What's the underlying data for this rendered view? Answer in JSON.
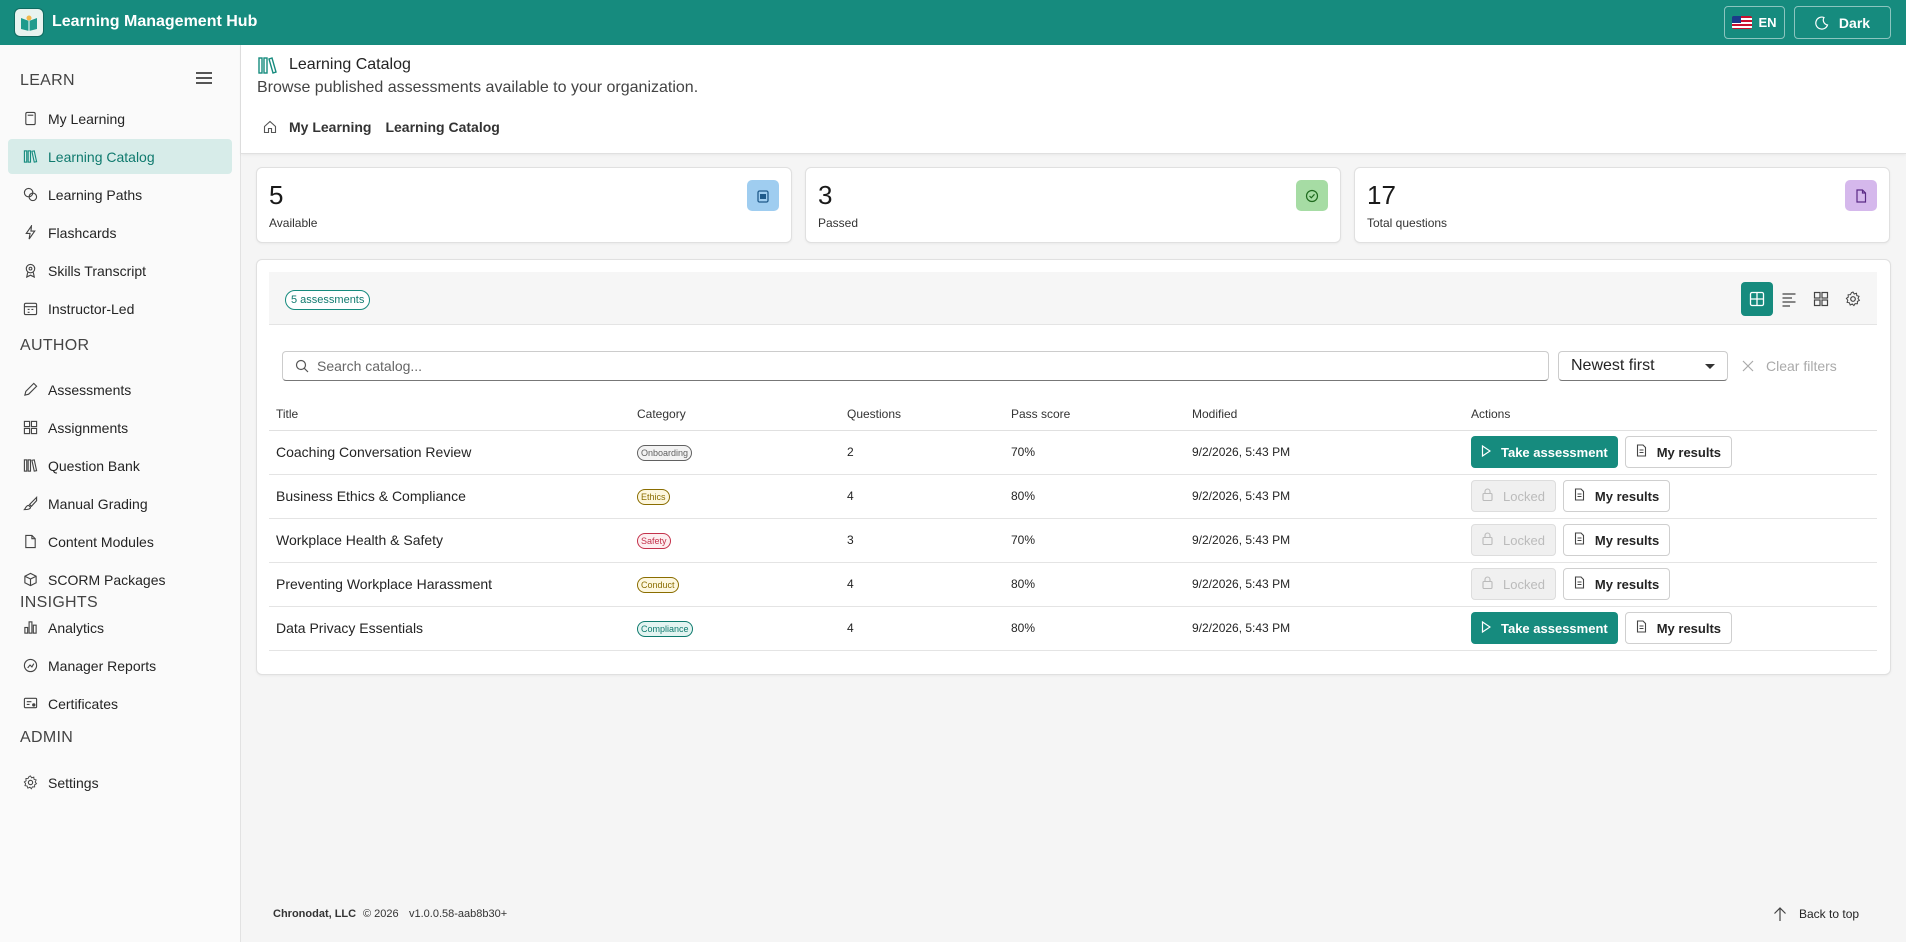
{
  "app": {
    "title": "Learning Management Hub",
    "language": "EN",
    "theme_label": "Dark"
  },
  "colors": {
    "brand": "#168b7e",
    "active_bg": "#d7ece9"
  },
  "sidebar": {
    "sections": [
      {
        "heading": "LEARN",
        "items": [
          {
            "label": "My Learning",
            "icon": "book-icon"
          },
          {
            "label": "Learning Catalog",
            "icon": "library-icon",
            "active": true
          },
          {
            "label": "Learning Paths",
            "icon": "paths-icon"
          },
          {
            "label": "Flashcards",
            "icon": "flash-icon"
          },
          {
            "label": "Skills Transcript",
            "icon": "ribbon-icon"
          },
          {
            "label": "Instructor-Led",
            "icon": "calendar-icon"
          }
        ]
      },
      {
        "heading": "AUTHOR",
        "items": [
          {
            "label": "Assessments",
            "icon": "pencil-icon"
          },
          {
            "label": "Assignments",
            "icon": "grid-icon"
          },
          {
            "label": "Question Bank",
            "icon": "library-icon"
          },
          {
            "label": "Manual Grading",
            "icon": "brush-icon"
          },
          {
            "label": "Content Modules",
            "icon": "document-icon"
          },
          {
            "label": "SCORM Packages",
            "icon": "cube-icon"
          }
        ]
      },
      {
        "heading": "INSIGHTS",
        "items": [
          {
            "label": "Analytics",
            "icon": "bar-chart-icon"
          },
          {
            "label": "Manager Reports",
            "icon": "report-icon"
          },
          {
            "label": "Certificates",
            "icon": "certificate-icon"
          }
        ]
      },
      {
        "heading": "ADMIN",
        "items": [
          {
            "label": "Settings",
            "icon": "gear-icon"
          }
        ]
      }
    ]
  },
  "header": {
    "title": "Learning Catalog",
    "subtitle": "Browse published assessments available to your organization.",
    "breadcrumb": [
      "My Learning",
      "Learning Catalog"
    ]
  },
  "stats": [
    {
      "value": "5",
      "label": "Available",
      "icon": "clipboard-icon",
      "color": "#9fcdf0"
    },
    {
      "value": "3",
      "label": "Passed",
      "icon": "check-circle-icon",
      "color": "#a6dca4"
    },
    {
      "value": "17",
      "label": "Total questions",
      "icon": "document-icon",
      "color": "#d5b8ec"
    }
  ],
  "catalog": {
    "count_label": "5 assessments",
    "search_placeholder": "Search catalog...",
    "sort_label": "Newest first",
    "clear_label": "Clear filters",
    "columns": [
      "Title",
      "Category",
      "Questions",
      "Pass score",
      "Modified",
      "Actions"
    ],
    "take_label": "Take assessment",
    "locked_label": "Locked",
    "results_label": "My results",
    "rows": [
      {
        "title": "Coaching Conversation Review",
        "category": "Onboarding",
        "cat_color": "#616161",
        "cat_bg": "#f3f3f3",
        "questions": "2",
        "pass": "70%",
        "modified": "9/2/2026, 5:43 PM",
        "state": "take"
      },
      {
        "title": "Business Ethics & Compliance",
        "category": "Ethics",
        "cat_color": "#8a6d00",
        "cat_bg": "#fdf7df",
        "questions": "4",
        "pass": "80%",
        "modified": "9/2/2026, 5:43 PM",
        "state": "locked"
      },
      {
        "title": "Workplace Health & Safety",
        "category": "Safety",
        "cat_color": "#c4314b",
        "cat_bg": "#fdeef0",
        "questions": "3",
        "pass": "70%",
        "modified": "9/2/2026, 5:43 PM",
        "state": "locked"
      },
      {
        "title": "Preventing Workplace Harassment",
        "category": "Conduct",
        "cat_color": "#8a6d00",
        "cat_bg": "#fdf7df",
        "questions": "4",
        "pass": "80%",
        "modified": "9/2/2026, 5:43 PM",
        "state": "locked"
      },
      {
        "title": "Data Privacy Essentials",
        "category": "Compliance",
        "cat_color": "#0f7a6e",
        "cat_bg": "#e3f4f1",
        "questions": "4",
        "pass": "80%",
        "modified": "9/2/2026, 5:43 PM",
        "state": "take"
      }
    ]
  },
  "footer": {
    "company": "Chronodat, LLC",
    "copyright": "© 2026",
    "version": "v1.0.0.58-aab8b30+",
    "back_to_top": "Back to top"
  }
}
